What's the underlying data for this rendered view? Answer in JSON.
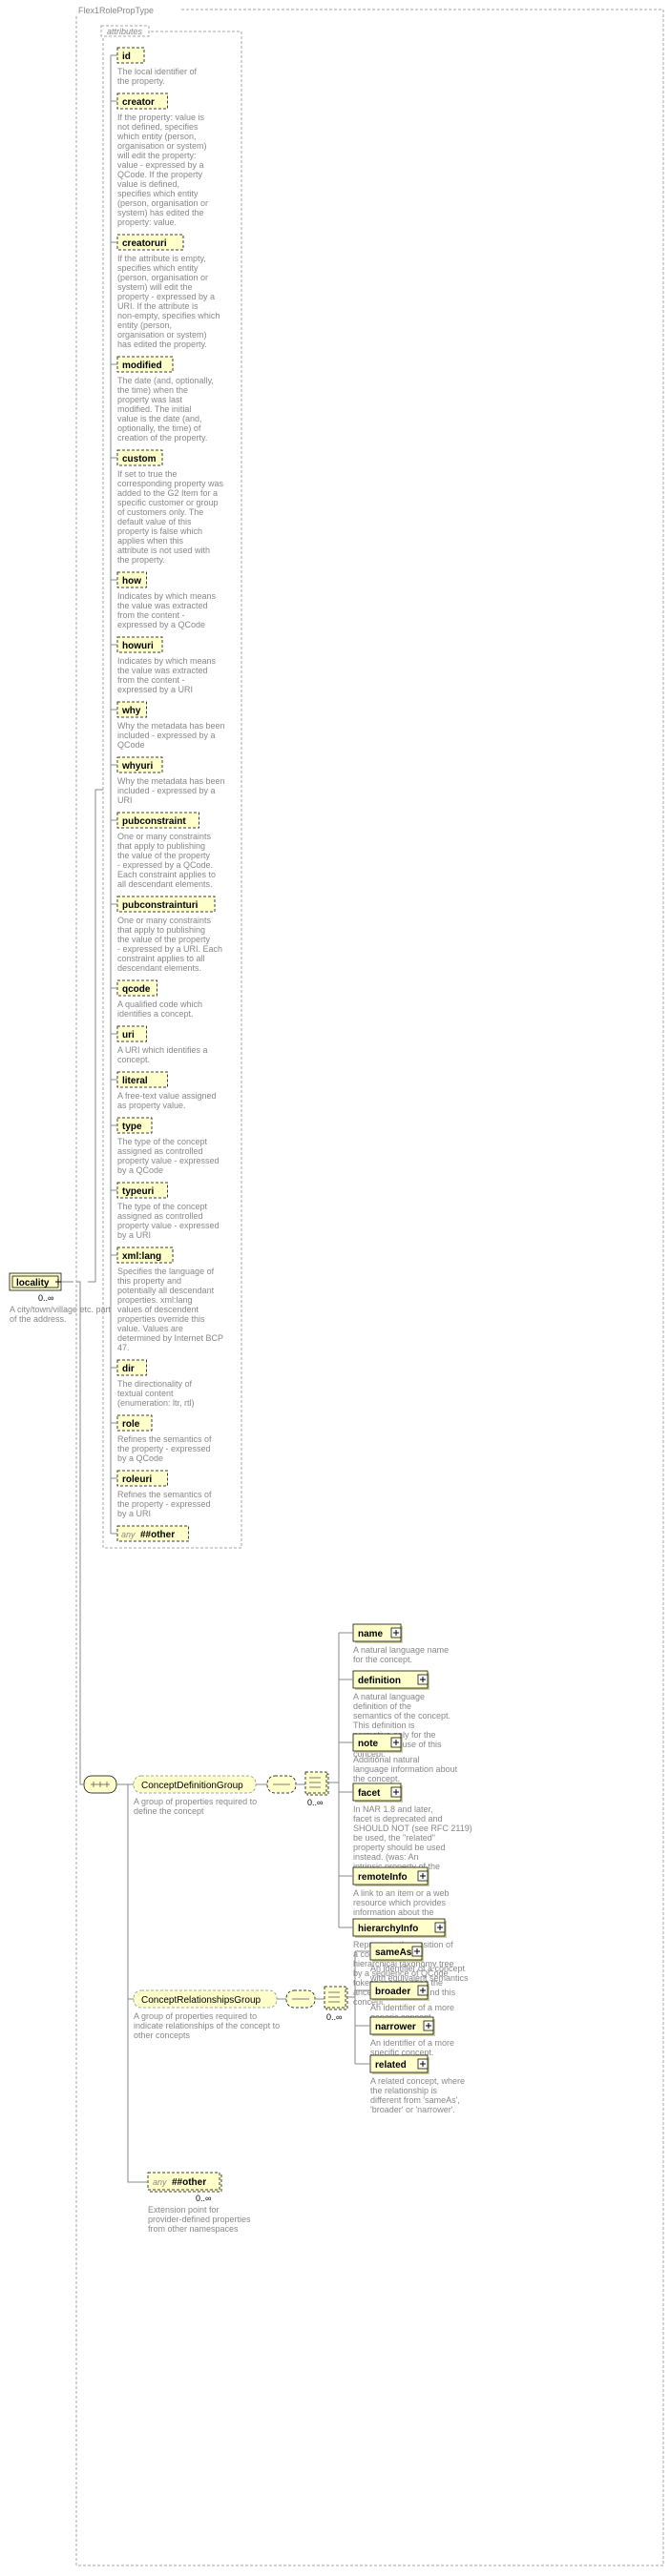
{
  "root": {
    "title": "Flex1RolePropType",
    "element": {
      "name": "locality",
      "occ": "0..∞",
      "desc": "A city/town/village etc. part of the address."
    }
  },
  "attributes_label": "attributes",
  "attributes": [
    {
      "name": "id",
      "desc": "The local identifier of the property."
    },
    {
      "name": "creator",
      "desc": "If the property: value is not defined, specifies which entity (person, organisation or system) will edit the property: value - expressed by a QCode. If the property value is defined, specifies which entity (person, organisation or system) has edited the property: value."
    },
    {
      "name": "creatoruri",
      "desc": "If the attribute is empty, specifies which entity (person, organisation or system) will edit the property - expressed by a URI. If the attribute is non-empty, specifies which entity (person, organisation or system) has edited the property."
    },
    {
      "name": "modified",
      "desc": "The date (and, optionally, the time) when the property was last modified. The initial value is the date (and, optionally, the time) of creation of the property."
    },
    {
      "name": "custom",
      "desc": "If set to true the corresponding property was added to the G2 Item for a specific customer or group of customers only. The default value of this property is false which applies when this attribute is not used with the property."
    },
    {
      "name": "how",
      "desc": "Indicates by which means the value was extracted from the content - expressed by a QCode"
    },
    {
      "name": "howuri",
      "desc": "Indicates by which means the value was extracted from the content - expressed by a URI"
    },
    {
      "name": "why",
      "desc": "Why the metadata has been included - expressed by a QCode"
    },
    {
      "name": "whyuri",
      "desc": "Why the metadata has been included - expressed by a URI"
    },
    {
      "name": "pubconstraint",
      "desc": "One or many constraints that apply to publishing the value of the property - expressed by a QCode. Each constraint applies to all descendant elements."
    },
    {
      "name": "pubconstrainturi",
      "desc": "One or many constraints that apply to publishing the value of the property - expressed by a URI. Each constraint applies to all descendant elements."
    },
    {
      "name": "qcode",
      "desc": "A qualified code which identifies a concept."
    },
    {
      "name": "uri",
      "desc": "A URI which identifies a concept."
    },
    {
      "name": "literal",
      "desc": "A free-text value assigned as property value."
    },
    {
      "name": "type",
      "desc": "The type of the concept assigned as controlled property value - expressed by a QCode"
    },
    {
      "name": "typeuri",
      "desc": "The type of the concept assigned as controlled property value - expressed by a URI"
    },
    {
      "name": "xml:lang",
      "desc": "Specifies the language of this property and potentially all descendant properties. xml:lang values of descendent properties override this value. Values are determined by Internet BCP 47."
    },
    {
      "name": "dir",
      "desc": "The directionality of textual content (enumeration: ltr, rtl)"
    },
    {
      "name": "role",
      "desc": "Refines the semantics of the property - expressed by a QCode"
    },
    {
      "name": "roleuri",
      "desc": "Refines the semantics of the property - expressed by a URI"
    },
    {
      "name": "##other",
      "desc": "",
      "any": true
    }
  ],
  "groups": {
    "definition": {
      "name": "ConceptDefinitionGroup",
      "desc": "A group of properties required to define the concept",
      "occ": "0..∞"
    },
    "relationships": {
      "name": "ConceptRelationshipsGroup",
      "desc": "A group of properties required to indicate relationships of the concept to other concepts",
      "occ": "0..∞"
    }
  },
  "def_children": [
    {
      "name": "name",
      "desc": "A natural language name for the concept."
    },
    {
      "name": "definition",
      "desc": "A natural language definition of the semantics of the concept. This definition is normative only for the scope of the use of this concept."
    },
    {
      "name": "note",
      "desc": "Additional natural language information about the concept."
    },
    {
      "name": "facet",
      "desc": "In NAR 1.8 and later, facet is deprecated and SHOULD NOT (see RFC 2119) be used, the \"related\" property should be used instead. (was: An intrinsic property of the concept.)"
    },
    {
      "name": "remoteInfo",
      "desc": "A link to an item or a web resource which provides information about the concept"
    },
    {
      "name": "hierarchyInfo",
      "desc": "Represents the position of a concept in a hierarchical taxonomy tree by a sequence of QCode tokens representing the ancestor concepts and this concept"
    }
  ],
  "rel_children": [
    {
      "name": "sameAs",
      "desc": "An identifier of a concept with equivalent semantics"
    },
    {
      "name": "broader",
      "desc": "An identifier of a more generic concept."
    },
    {
      "name": "narrower",
      "desc": "An identifier of a more specific concept."
    },
    {
      "name": "related",
      "desc": "A related concept, where the relationship is different from 'sameAs', 'broader' or 'narrower'."
    }
  ],
  "any_ext": {
    "name": "##other",
    "occ": "0..∞",
    "desc": "Extension point for provider-defined properties from other namespaces"
  },
  "any_label": "any"
}
